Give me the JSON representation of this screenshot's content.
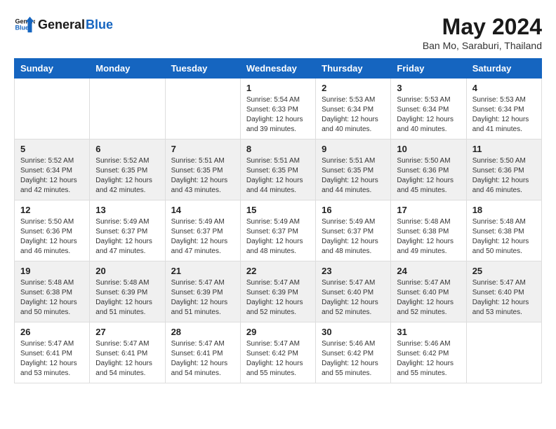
{
  "header": {
    "logo_general": "General",
    "logo_blue": "Blue",
    "month": "May 2024",
    "location": "Ban Mo, Saraburi, Thailand"
  },
  "weekdays": [
    "Sunday",
    "Monday",
    "Tuesday",
    "Wednesday",
    "Thursday",
    "Friday",
    "Saturday"
  ],
  "weeks": [
    [
      {
        "day": "",
        "info": ""
      },
      {
        "day": "",
        "info": ""
      },
      {
        "day": "",
        "info": ""
      },
      {
        "day": "1",
        "info": "Sunrise: 5:54 AM\nSunset: 6:33 PM\nDaylight: 12 hours\nand 39 minutes."
      },
      {
        "day": "2",
        "info": "Sunrise: 5:53 AM\nSunset: 6:34 PM\nDaylight: 12 hours\nand 40 minutes."
      },
      {
        "day": "3",
        "info": "Sunrise: 5:53 AM\nSunset: 6:34 PM\nDaylight: 12 hours\nand 40 minutes."
      },
      {
        "day": "4",
        "info": "Sunrise: 5:53 AM\nSunset: 6:34 PM\nDaylight: 12 hours\nand 41 minutes."
      }
    ],
    [
      {
        "day": "5",
        "info": "Sunrise: 5:52 AM\nSunset: 6:34 PM\nDaylight: 12 hours\nand 42 minutes."
      },
      {
        "day": "6",
        "info": "Sunrise: 5:52 AM\nSunset: 6:35 PM\nDaylight: 12 hours\nand 42 minutes."
      },
      {
        "day": "7",
        "info": "Sunrise: 5:51 AM\nSunset: 6:35 PM\nDaylight: 12 hours\nand 43 minutes."
      },
      {
        "day": "8",
        "info": "Sunrise: 5:51 AM\nSunset: 6:35 PM\nDaylight: 12 hours\nand 44 minutes."
      },
      {
        "day": "9",
        "info": "Sunrise: 5:51 AM\nSunset: 6:35 PM\nDaylight: 12 hours\nand 44 minutes."
      },
      {
        "day": "10",
        "info": "Sunrise: 5:50 AM\nSunset: 6:36 PM\nDaylight: 12 hours\nand 45 minutes."
      },
      {
        "day": "11",
        "info": "Sunrise: 5:50 AM\nSunset: 6:36 PM\nDaylight: 12 hours\nand 46 minutes."
      }
    ],
    [
      {
        "day": "12",
        "info": "Sunrise: 5:50 AM\nSunset: 6:36 PM\nDaylight: 12 hours\nand 46 minutes."
      },
      {
        "day": "13",
        "info": "Sunrise: 5:49 AM\nSunset: 6:37 PM\nDaylight: 12 hours\nand 47 minutes."
      },
      {
        "day": "14",
        "info": "Sunrise: 5:49 AM\nSunset: 6:37 PM\nDaylight: 12 hours\nand 47 minutes."
      },
      {
        "day": "15",
        "info": "Sunrise: 5:49 AM\nSunset: 6:37 PM\nDaylight: 12 hours\nand 48 minutes."
      },
      {
        "day": "16",
        "info": "Sunrise: 5:49 AM\nSunset: 6:37 PM\nDaylight: 12 hours\nand 48 minutes."
      },
      {
        "day": "17",
        "info": "Sunrise: 5:48 AM\nSunset: 6:38 PM\nDaylight: 12 hours\nand 49 minutes."
      },
      {
        "day": "18",
        "info": "Sunrise: 5:48 AM\nSunset: 6:38 PM\nDaylight: 12 hours\nand 50 minutes."
      }
    ],
    [
      {
        "day": "19",
        "info": "Sunrise: 5:48 AM\nSunset: 6:38 PM\nDaylight: 12 hours\nand 50 minutes."
      },
      {
        "day": "20",
        "info": "Sunrise: 5:48 AM\nSunset: 6:39 PM\nDaylight: 12 hours\nand 51 minutes."
      },
      {
        "day": "21",
        "info": "Sunrise: 5:47 AM\nSunset: 6:39 PM\nDaylight: 12 hours\nand 51 minutes."
      },
      {
        "day": "22",
        "info": "Sunrise: 5:47 AM\nSunset: 6:39 PM\nDaylight: 12 hours\nand 52 minutes."
      },
      {
        "day": "23",
        "info": "Sunrise: 5:47 AM\nSunset: 6:40 PM\nDaylight: 12 hours\nand 52 minutes."
      },
      {
        "day": "24",
        "info": "Sunrise: 5:47 AM\nSunset: 6:40 PM\nDaylight: 12 hours\nand 52 minutes."
      },
      {
        "day": "25",
        "info": "Sunrise: 5:47 AM\nSunset: 6:40 PM\nDaylight: 12 hours\nand 53 minutes."
      }
    ],
    [
      {
        "day": "26",
        "info": "Sunrise: 5:47 AM\nSunset: 6:41 PM\nDaylight: 12 hours\nand 53 minutes."
      },
      {
        "day": "27",
        "info": "Sunrise: 5:47 AM\nSunset: 6:41 PM\nDaylight: 12 hours\nand 54 minutes."
      },
      {
        "day": "28",
        "info": "Sunrise: 5:47 AM\nSunset: 6:41 PM\nDaylight: 12 hours\nand 54 minutes."
      },
      {
        "day": "29",
        "info": "Sunrise: 5:47 AM\nSunset: 6:42 PM\nDaylight: 12 hours\nand 55 minutes."
      },
      {
        "day": "30",
        "info": "Sunrise: 5:46 AM\nSunset: 6:42 PM\nDaylight: 12 hours\nand 55 minutes."
      },
      {
        "day": "31",
        "info": "Sunrise: 5:46 AM\nSunset: 6:42 PM\nDaylight: 12 hours\nand 55 minutes."
      },
      {
        "day": "",
        "info": ""
      }
    ]
  ]
}
